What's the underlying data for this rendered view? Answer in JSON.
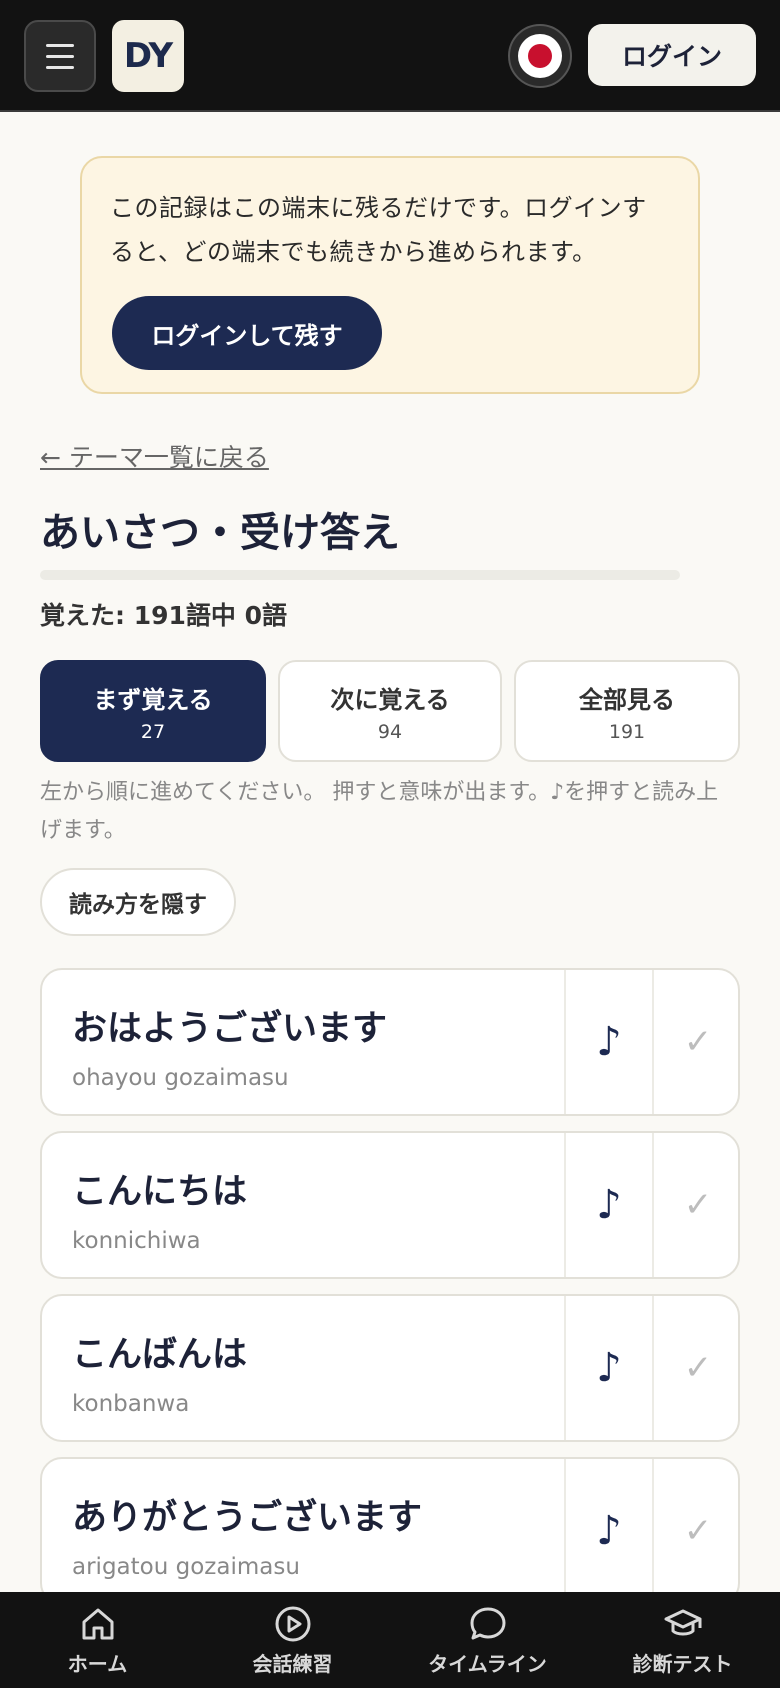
{
  "header": {
    "logo_text": "DY",
    "login_label": "ログイン",
    "language_icon": "japan-flag-icon"
  },
  "notice": {
    "text": "この記録はこの端末に残るだけです。ログインすると、どの端末でも続きから進められます。",
    "button_label": "ログインして残す"
  },
  "nav_back": {
    "label": "← テーマ一覧に戻る"
  },
  "page": {
    "title": "あいさつ・受け答え",
    "progress_text": "覚えた: 191語中 0語",
    "progress_fraction": 0
  },
  "tabs": [
    {
      "label": "まず覚える",
      "count": "27",
      "active": true
    },
    {
      "label": "次に覚える",
      "count": "94",
      "active": false
    },
    {
      "label": "全部見る",
      "count": "191",
      "active": false
    }
  ],
  "hint": "左から順に進めてください。 押すと意味が出ます。♪を押すと読み上げます。",
  "toggle_reading_label": "読み方を隠す",
  "words": [
    {
      "jp": "おはようございます",
      "romaji": "ohayou gozaimasu",
      "audio_glyph": "♪",
      "check_glyph": "✓"
    },
    {
      "jp": "こんにちは",
      "romaji": "konnichiwa",
      "audio_glyph": "♪",
      "check_glyph": "✓"
    },
    {
      "jp": "こんばんは",
      "romaji": "konbanwa",
      "audio_glyph": "♪",
      "check_glyph": "✓"
    },
    {
      "jp": "ありがとうございます",
      "romaji": "arigatou gozaimasu",
      "audio_glyph": "♪",
      "check_glyph": "✓"
    }
  ],
  "bottom_nav": [
    {
      "label": "ホーム",
      "icon": "home-icon"
    },
    {
      "label": "会話練習",
      "icon": "play-circle-icon"
    },
    {
      "label": "タイムライン",
      "icon": "chat-bubble-icon"
    },
    {
      "label": "診断テスト",
      "icon": "graduation-cap-icon"
    }
  ],
  "colors": {
    "accent": "#1d2a52",
    "header_bg": "#121212",
    "notice_bg": "#fdf5e3",
    "page_bg": "#faf9f5"
  }
}
